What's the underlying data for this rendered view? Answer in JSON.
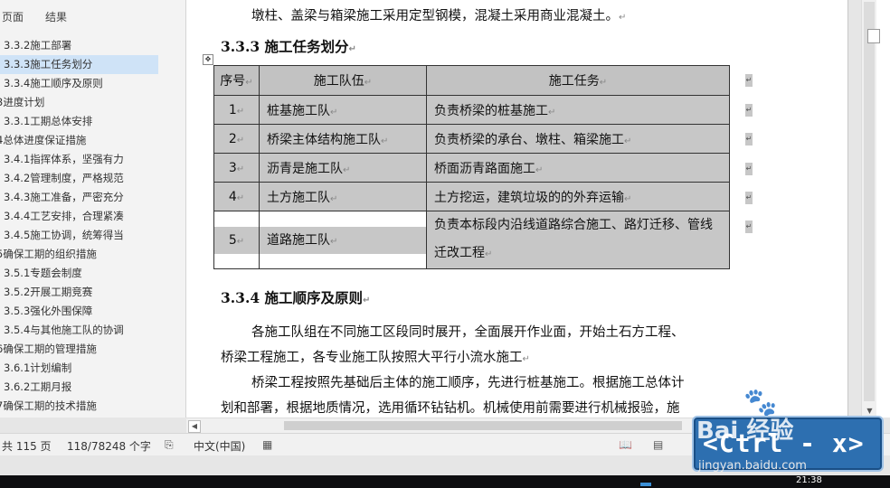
{
  "nav": {
    "tabs": [
      "页面",
      "结果"
    ],
    "items": [
      {
        "label": "3.3.2施工部署",
        "level": 2,
        "selected": false
      },
      {
        "label": "3.3.3施工任务划分",
        "level": 2,
        "selected": true
      },
      {
        "label": "3.3.4施工顺序及原则",
        "level": 2,
        "selected": false
      },
      {
        "label": "3进度计划",
        "level": 1,
        "selected": false
      },
      {
        "label": "3.3.1工期总体安排",
        "level": 2,
        "selected": false
      },
      {
        "label": "4总体进度保证措施",
        "level": 1,
        "selected": false
      },
      {
        "label": "3.4.1指挥体系，坚强有力",
        "level": 2,
        "selected": false
      },
      {
        "label": "3.4.2管理制度，严格规范",
        "level": 2,
        "selected": false
      },
      {
        "label": "3.4.3施工准备，严密充分",
        "level": 2,
        "selected": false
      },
      {
        "label": "3.4.4工艺安排，合理紧凑",
        "level": 2,
        "selected": false
      },
      {
        "label": "3.4.5施工协调，统筹得当",
        "level": 2,
        "selected": false
      },
      {
        "label": "5确保工期的组织措施",
        "level": 1,
        "selected": false
      },
      {
        "label": "3.5.1专题会制度",
        "level": 2,
        "selected": false
      },
      {
        "label": "3.5.2开展工期竞赛",
        "level": 2,
        "selected": false
      },
      {
        "label": "3.5.3强化外围保障",
        "level": 2,
        "selected": false
      },
      {
        "label": "3.5.4与其他施工队的协调",
        "level": 2,
        "selected": false
      },
      {
        "label": "6确保工期的管理措施",
        "level": 1,
        "selected": false
      },
      {
        "label": "3.6.1计划编制",
        "level": 2,
        "selected": false
      },
      {
        "label": "3.6.2工期月报",
        "level": 2,
        "selected": false
      },
      {
        "label": "7确保工期的技术措施",
        "level": 1,
        "selected": false
      }
    ]
  },
  "doc": {
    "intro_para": "墩柱、盖梁与箱梁施工采用定型钢模，混凝土采用商业混凝土。",
    "heading1": "3.3.3 施工任务划分",
    "table": {
      "headers": [
        "序号",
        "施工队伍",
        "施工任务"
      ],
      "rows": [
        [
          "1",
          "桩基施工队",
          "负责桥梁的桩基施工"
        ],
        [
          "2",
          "桥梁主体结构施工队",
          "负责桥梁的承台、墩柱、箱梁施工"
        ],
        [
          "3",
          "沥青是施工队",
          "桥面沥青路面施工"
        ],
        [
          "4",
          "土方施工队",
          "土方挖运，建筑垃圾的的外弃运输"
        ],
        [
          "5",
          "道路施工队",
          "负责本标段内沿线道路综合施工、路灯迁移、管线迁改工程"
        ]
      ]
    },
    "heading2": "3.3.4 施工顺序及原则",
    "para1_line1": "各施工队组在不同施工区段同时展开，全面展开作业面，开始土石方工程、",
    "para1_line2": "桥梁工程施工，各专业施工队按照大平行小流水施工",
    "para2_line1": "桥梁工程按照先基础后主体的施工顺序，先进行桩基施工。根据施工总体计",
    "para2_line2": "划和部署，根据地质情况，选用循环钻钻机。机械使用前需要进行机械报验，施"
  },
  "status": {
    "pages": "共 115 页",
    "words": "118/78248 个字",
    "language": "中文(中国)"
  },
  "taskbar": {
    "time": "21:38"
  },
  "overlay": {
    "keycap": "<Ctrl - x>",
    "logo": "Bai 经验",
    "url": "jingyan.baidu.com"
  }
}
